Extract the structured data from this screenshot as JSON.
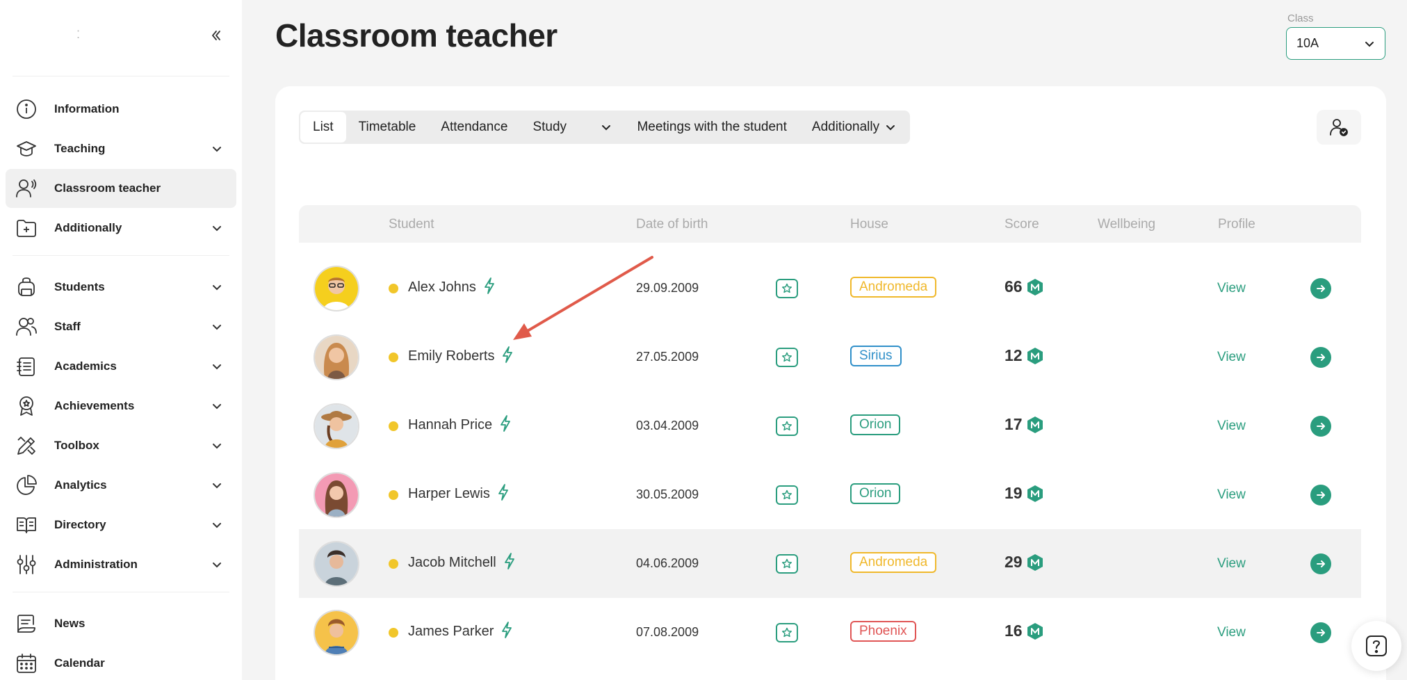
{
  "colors": {
    "accent": "#2a9d7e",
    "andromeda": "#f0b82b",
    "sirius": "#2f8fc9",
    "orion": "#2a9d7e",
    "phoenix": "#e05555",
    "status": "#f1c62a"
  },
  "sidebar": {
    "items": [
      {
        "label": "Information",
        "icon": "info-icon"
      },
      {
        "label": "Teaching",
        "icon": "graduation-cap-icon"
      },
      {
        "label": "Classroom teacher",
        "icon": "teacher-icon"
      },
      {
        "label": "Additionally",
        "icon": "folder-plus-icon"
      },
      {
        "label": "Students",
        "icon": "backpack-icon"
      },
      {
        "label": "Staff",
        "icon": "users-icon"
      },
      {
        "label": "Academics",
        "icon": "notebook-icon"
      },
      {
        "label": "Achievements",
        "icon": "award-icon"
      },
      {
        "label": "Toolbox",
        "icon": "pencil-ruler-icon"
      },
      {
        "label": "Analytics",
        "icon": "pie-chart-icon"
      },
      {
        "label": "Directory",
        "icon": "book-open-icon"
      },
      {
        "label": "Administration",
        "icon": "sliders-icon"
      },
      {
        "label": "News",
        "icon": "news-icon"
      },
      {
        "label": "Calendar",
        "icon": "calendar-icon"
      }
    ]
  },
  "header": {
    "title": "Classroom teacher",
    "class_label": "Class",
    "class_value": "10A"
  },
  "tabs": [
    "List",
    "Timetable",
    "Attendance",
    "Study",
    "Meetings with the student",
    "Additionally"
  ],
  "table": {
    "columns": [
      "Student",
      "Date of birth",
      "House",
      "Score",
      "Wellbeing",
      "Profile"
    ],
    "view_label": "View",
    "rows": [
      {
        "name": "Alex Johns",
        "dob": "29.09.2009",
        "house": "Andromeda",
        "score": "66"
      },
      {
        "name": "Emily Roberts",
        "dob": "27.05.2009",
        "house": "Sirius",
        "score": "12"
      },
      {
        "name": "Hannah Price",
        "dob": "03.04.2009",
        "house": "Orion",
        "score": "17"
      },
      {
        "name": "Harper Lewis",
        "dob": "30.05.2009",
        "house": "Orion",
        "score": "19"
      },
      {
        "name": "Jacob Mitchell",
        "dob": "04.06.2009",
        "house": "Andromeda",
        "score": "29"
      },
      {
        "name": "James Parker",
        "dob": "07.08.2009",
        "house": "Phoenix",
        "score": "16"
      }
    ]
  }
}
